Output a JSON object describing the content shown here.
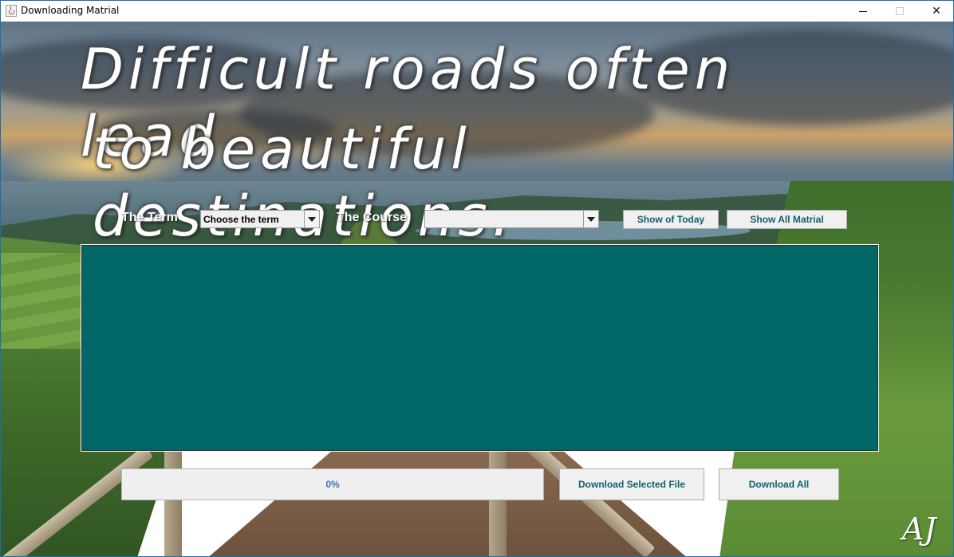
{
  "window": {
    "title": "Downloading Matrial",
    "controls": {
      "minimize": "minimize",
      "maximize": "maximize",
      "close": "✕"
    }
  },
  "banner": {
    "line1": "Difficult roads often lead",
    "line2": "to beautiful destinations."
  },
  "filters": {
    "term_label": "The Term",
    "term_selected": "Choose the term",
    "course_label": "The Course",
    "course_selected": ""
  },
  "actions": {
    "show_today": "Show of Today",
    "show_all": "Show All Matrial",
    "download_selected": "Download Selected File",
    "download_all": "Download All"
  },
  "progress": {
    "value": 0,
    "text": "0%"
  },
  "signature": "AJ",
  "colors": {
    "panel": "#006666",
    "button_text": "#105f6d",
    "progress_text": "#3e6fb5"
  },
  "icons": {
    "app": "java-cup-icon",
    "dropdown": "chevron-down-icon"
  }
}
